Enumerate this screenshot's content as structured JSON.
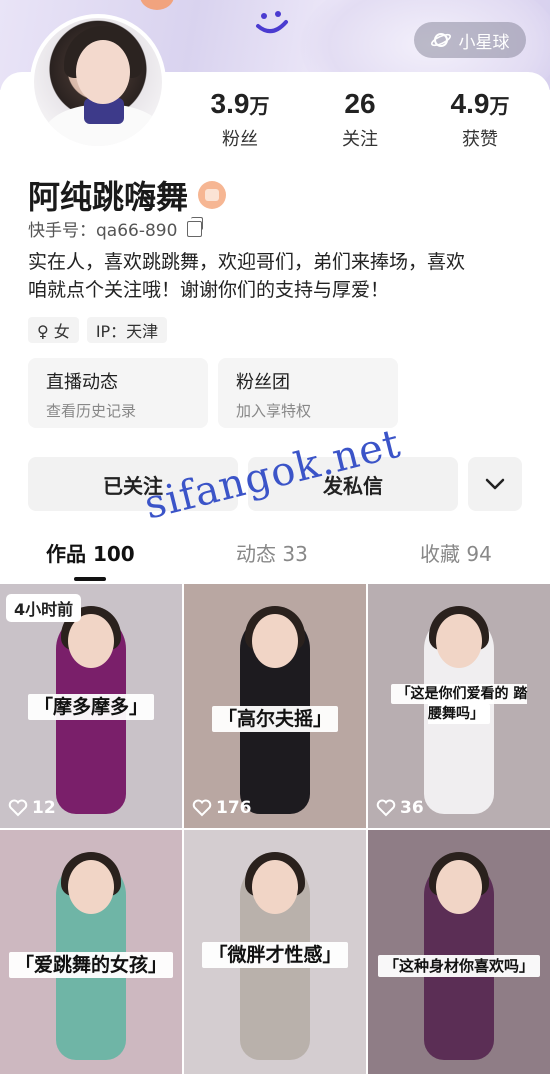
{
  "header": {
    "planet_label": "小星球"
  },
  "profile": {
    "name": "阿纯跳嗨舞",
    "kuaishou_id": "快手号：qa66-890",
    "bio_line1": "实在人，喜欢跳跳舞，欢迎哥们，弟们来捧场，喜欢",
    "bio_line2": "咱就点个关注哦！谢谢你们的支持与厚爱！",
    "gender_tag": "♀ 女",
    "ip_tag": "IP：天津"
  },
  "stats": [
    {
      "value": "3.9",
      "unit": "万",
      "label": "粉丝"
    },
    {
      "value": "26",
      "unit": "",
      "label": "关注"
    },
    {
      "value": "4.9",
      "unit": "万",
      "label": "获赞"
    }
  ],
  "cards": [
    {
      "title": "直播动态",
      "subtitle": "查看历史记录"
    },
    {
      "title": "粉丝团",
      "subtitle": "加入享特权"
    }
  ],
  "actions": {
    "followed": "已关注",
    "message": "发私信"
  },
  "tabs": [
    {
      "label": "作品 100"
    },
    {
      "label": "动态 33"
    },
    {
      "label": "收藏 94"
    }
  ],
  "watermark": "sifangok.net",
  "videos": [
    {
      "caption": "「摩多摩多」",
      "likes": "12",
      "time": "4小时前",
      "bg": "#c9c2c8",
      "outfit": "#7a1f6a"
    },
    {
      "caption": "「高尔夫摇」",
      "likes": "176",
      "bg": "#b9a7a2",
      "outfit": "#1d1b1f"
    },
    {
      "caption": "「这是你们爱看的 踏腰舞吗」",
      "likes": "36",
      "bg": "#b8aeb1",
      "outfit": "#f0eef0"
    },
    {
      "caption": "「爱跳舞的女孩」",
      "likes": "",
      "bg": "#cdb8c0",
      "outfit": "#6fb5a6"
    },
    {
      "caption": "「微胖才性感」",
      "likes": "",
      "bg": "#d4cdd0",
      "outfit": "#b9b1ab"
    },
    {
      "caption": "「这种身材你喜欢吗」",
      "likes": "",
      "bg": "#8f7d86",
      "outfit": "#5b2e55"
    }
  ]
}
